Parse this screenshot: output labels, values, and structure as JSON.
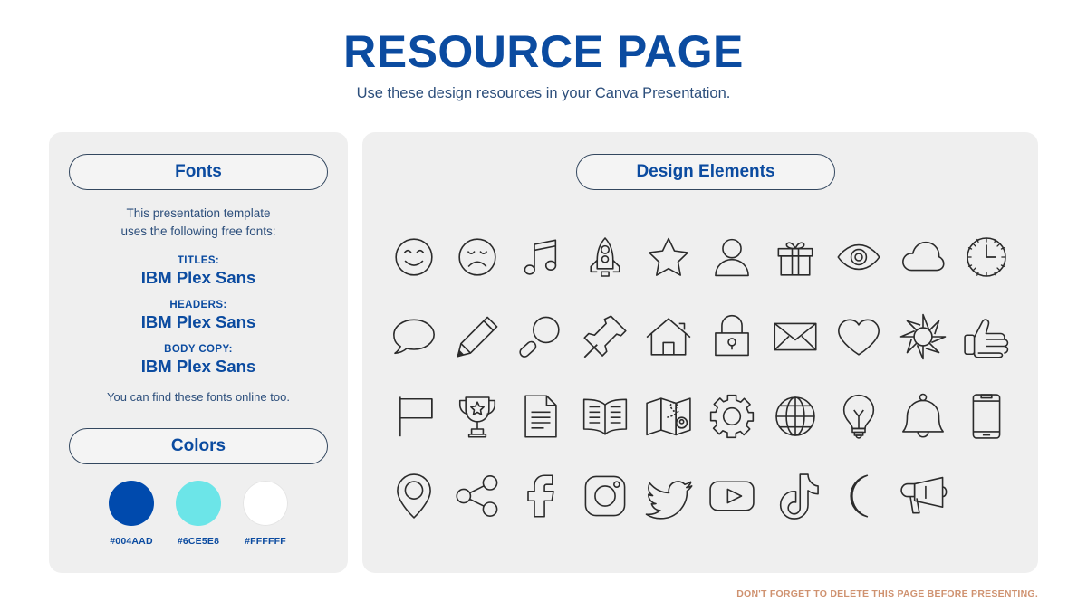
{
  "header": {
    "title": "RESOURCE PAGE",
    "subtitle": "Use these design resources in your Canva Presentation."
  },
  "fonts_panel": {
    "pill_label": "Fonts",
    "intro_line1": "This presentation template",
    "intro_line2": "uses the following free fonts:",
    "entries": [
      {
        "role": "TITLES:",
        "name": "IBM Plex Sans"
      },
      {
        "role": "HEADERS:",
        "name": "IBM Plex Sans"
      },
      {
        "role": "BODY COPY:",
        "name": "IBM Plex Sans"
      }
    ],
    "outro": "You can find these fonts online too."
  },
  "colors_panel": {
    "pill_label": "Colors",
    "swatches": [
      {
        "hex_label": "#004AAD",
        "hex": "#004AAD"
      },
      {
        "hex_label": "#6CE5E8",
        "hex": "#6CE5E8"
      },
      {
        "hex_label": "#FFFFFF",
        "hex": "#FFFFFF"
      }
    ]
  },
  "design_panel": {
    "pill_label": "Design Elements",
    "icons": [
      "smiley-face-icon",
      "sad-face-icon",
      "music-note-icon",
      "rocket-icon",
      "star-icon",
      "person-icon",
      "gift-icon",
      "eye-icon",
      "cloud-icon",
      "clock-icon",
      "speech-bubble-icon",
      "pencil-icon",
      "magnifying-glass-icon",
      "pushpin-icon",
      "house-icon",
      "lock-icon",
      "envelope-icon",
      "heart-icon",
      "sun-icon",
      "thumbs-up-icon",
      "flag-icon",
      "trophy-icon",
      "document-icon",
      "book-icon",
      "map-icon",
      "gear-icon",
      "globe-icon",
      "lightbulb-icon",
      "bell-icon",
      "smartphone-icon",
      "location-pin-icon",
      "share-icon",
      "facebook-icon",
      "instagram-icon",
      "twitter-icon",
      "youtube-icon",
      "tiktok-icon",
      "moon-icon",
      "megaphone-icon"
    ]
  },
  "footer": {
    "note": "DON'T FORGET TO DELETE THIS PAGE BEFORE PRESENTING."
  },
  "theme": {
    "brand_blue": "#004AAD",
    "accent_cyan": "#6CE5E8",
    "panel_gray": "#EFEFEF",
    "footer_orange": "#CF9270",
    "outline_navy": "#33475F"
  }
}
